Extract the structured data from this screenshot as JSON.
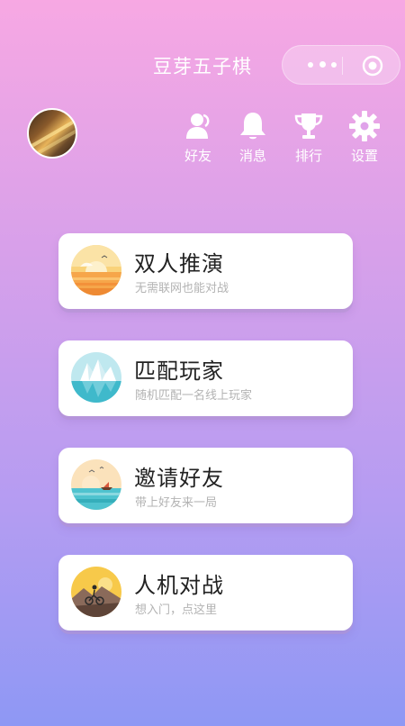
{
  "header": {
    "title": "豆芽五子棋"
  },
  "capsule": {
    "more_icon": "more-dots-icon",
    "close_icon": "target-icon"
  },
  "profile": {
    "avatar_icon": "avatar"
  },
  "nav": [
    {
      "label": "好友",
      "icon": "friends-icon"
    },
    {
      "label": "消息",
      "icon": "bell-icon"
    },
    {
      "label": "排行",
      "icon": "trophy-icon"
    },
    {
      "label": "设置",
      "icon": "gear-icon"
    }
  ],
  "modes": [
    {
      "title": "双人推演",
      "subtitle": "无需联网也能对战"
    },
    {
      "title": "匹配玩家",
      "subtitle": "随机匹配一名线上玩家"
    },
    {
      "title": "邀请好友",
      "subtitle": "带上好友来一局"
    },
    {
      "title": "人机对战",
      "subtitle": "想入门，点这里"
    }
  ]
}
